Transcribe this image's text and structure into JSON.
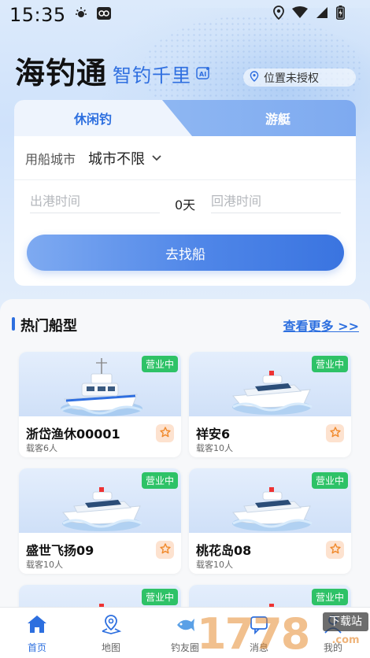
{
  "status_bar": {
    "time": "15:35"
  },
  "header": {
    "app_title": "海钓通",
    "slogan": "智钓千里",
    "location": "位置未授权"
  },
  "search": {
    "tabs": [
      {
        "label": "休闲钓",
        "active": true
      },
      {
        "label": "游艇",
        "active": false
      }
    ],
    "city_label": "用船城市",
    "city_value": "城市不限",
    "depart_placeholder": "出港时间",
    "return_placeholder": "回港时间",
    "days": "0天",
    "find_button": "去找船"
  },
  "hot": {
    "title": "热门船型",
    "more": "查看更多 >>",
    "boats": [
      {
        "name": "浙岱渔休00001",
        "capacity": "载客6人",
        "status": "营业中"
      },
      {
        "name": "祥安6",
        "capacity": "载客10人",
        "status": "营业中"
      },
      {
        "name": "盛世飞扬09",
        "capacity": "载客10人",
        "status": "营业中"
      },
      {
        "name": "桃花岛08",
        "capacity": "载客10人",
        "status": "营业中"
      },
      {
        "name": "",
        "capacity": "",
        "status": "营业中"
      },
      {
        "name": "",
        "capacity": "",
        "status": "营业中"
      }
    ]
  },
  "nav": {
    "items": [
      {
        "label": "首页",
        "icon": "home-icon",
        "active": true
      },
      {
        "label": "地图",
        "icon": "map-pin-icon",
        "active": false
      },
      {
        "label": "钓友圈",
        "icon": "fish-icon",
        "active": false
      },
      {
        "label": "消息",
        "icon": "message-icon",
        "active": false
      },
      {
        "label": "我的",
        "icon": "user-icon",
        "active": false
      }
    ]
  },
  "watermark": {
    "digits": "1778",
    "box": "下载站",
    "sub": ".com"
  },
  "colors": {
    "accent": "#2d6fdf",
    "badge": "#2ec267",
    "fav_bg": "#fde2cf"
  }
}
